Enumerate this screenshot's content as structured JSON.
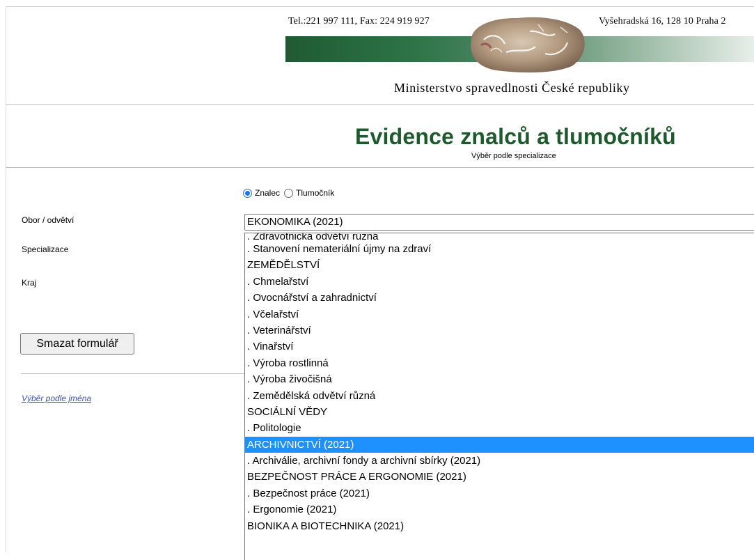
{
  "header": {
    "contact_phone": "Tel.:221 997 111, Fax: 224 919 927",
    "contact_address": "Vyšehradská 16, 128 10 Praha 2",
    "ministry": "Ministerstvo spravedlnosti České republiky"
  },
  "page": {
    "title": "Evidence znalců a tlumočníků",
    "subtitle": "Výběr podle specializace"
  },
  "form": {
    "radio_options": [
      {
        "label": "Znalec",
        "checked": true
      },
      {
        "label": "Tlumočník",
        "checked": false
      }
    ],
    "label_obor": "Obor / odvětví",
    "label_specializace": "Specializace",
    "label_kraj": "Kraj",
    "obor_selected": "EKONOMIKA (2021)",
    "clear_button": "Smazat formulář",
    "name_link": "Výběr podle jména"
  },
  "dropdown": {
    "options": [
      ". Zdravotnická odvětví různá",
      ". Stanovení nemateriální újmy na zdraví",
      "ZEMĚDĚLSTVÍ",
      ". Chmelařství",
      ". Ovocnářství a zahradnictví",
      ". Včelařství",
      ". Veterinářství",
      ". Vinařství",
      ". Výroba rostlinná",
      ". Výroba živočišná",
      ". Zemědělská odvětví různá",
      "SOCIÁLNÍ VĚDY",
      ". Politologie",
      "ARCHIVNICTVÍ (2021)",
      ". Archiválie, archivní fondy a archivní sbírky (2021)",
      "BEZPEČNOST PRÁCE A ERGONOMIE (2021)",
      ". Bezpečnost práce (2021)",
      ". Ergonomie (2021)",
      "BIONIKA A BIOTECHNIKA (2021)"
    ],
    "highlighted": "ARCHIVNICTVÍ (2021)"
  },
  "colors": {
    "title_green": "#1e5a2d",
    "highlight": "#1e90ff",
    "radio_accent": "#1a73e8",
    "link": "#3a55a8"
  }
}
